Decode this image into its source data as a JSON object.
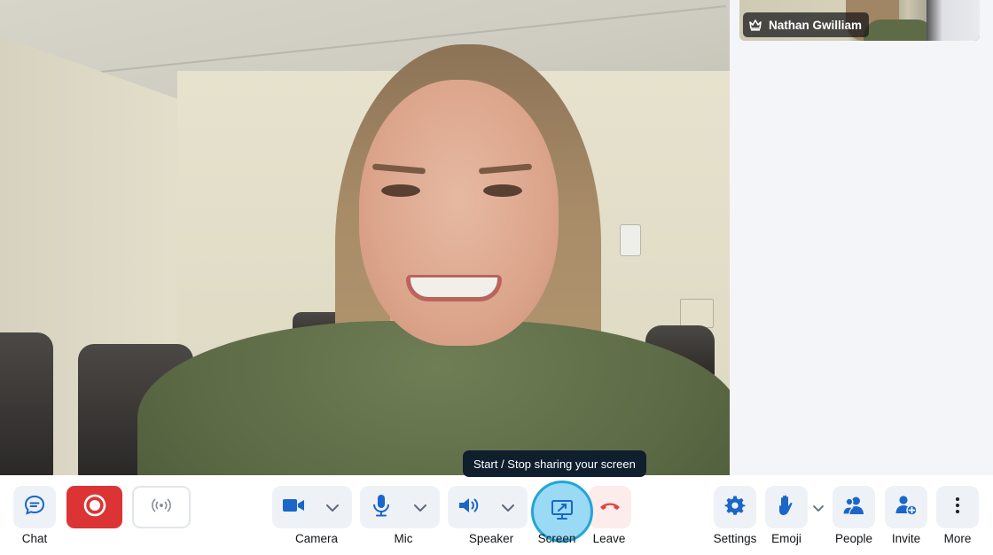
{
  "participant": {
    "name": "Nathan Gwilliam",
    "badge_icon": "crown-icon"
  },
  "tooltip": {
    "text": "Start / Stop sharing your screen"
  },
  "toolbar": {
    "chat": {
      "label": "Chat",
      "icon": "chat-icon"
    },
    "record": {
      "icon": "record-icon",
      "color": "#dc3434"
    },
    "live": {
      "icon": "broadcast-icon"
    },
    "camera": {
      "label": "Camera",
      "icon": "video-camera-icon"
    },
    "mic": {
      "label": "Mic",
      "icon": "microphone-icon"
    },
    "speaker": {
      "label": "Speaker",
      "icon": "speaker-icon"
    },
    "screen": {
      "label": "Screen",
      "icon": "screen-share-icon"
    },
    "leave": {
      "label": "Leave",
      "icon": "hang-up-icon",
      "color": "#e0453f"
    },
    "settings": {
      "label": "Settings",
      "icon": "gear-icon"
    },
    "emoji": {
      "label": "Emoji",
      "icon": "raised-hand-icon"
    },
    "people": {
      "label": "People",
      "icon": "people-icon"
    },
    "invite": {
      "label": "Invite",
      "icon": "add-person-icon"
    },
    "more": {
      "label": "More",
      "icon": "vertical-dots-icon"
    }
  },
  "colors": {
    "accent": "#1f6fd1",
    "icon_blue": "#1a66c9",
    "button_bg": "#eef2f7",
    "tooltip_bg": "#0f1f2e",
    "screen_highlight": "#21a6d6"
  }
}
